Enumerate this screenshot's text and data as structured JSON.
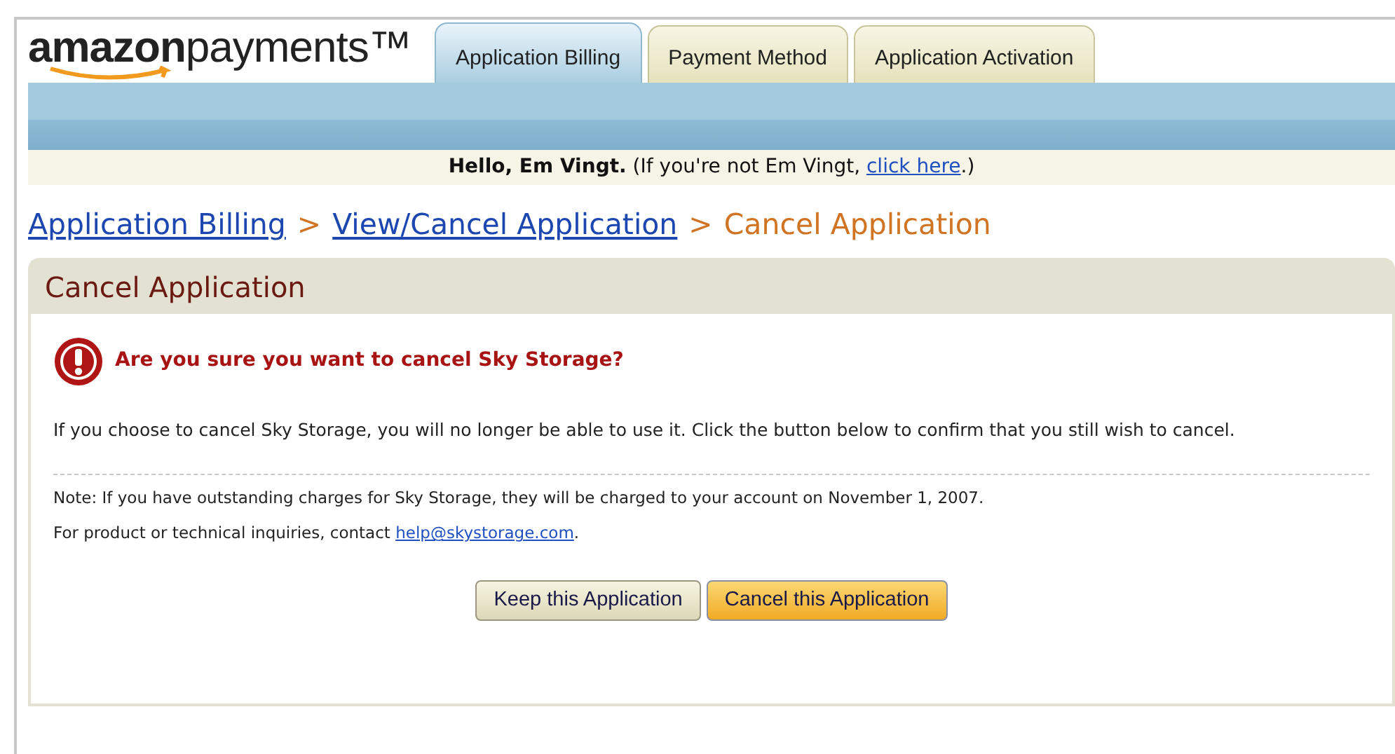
{
  "logo": {
    "text": "**amazon**payments™"
  },
  "tabs": [
    {
      "label": "Application Billing",
      "selected": true
    },
    {
      "label": "Payment Method",
      "selected": false
    },
    {
      "label": "Application Activation",
      "selected": false
    }
  ],
  "greeting": {
    "before": "**Hello, Em Vingt.** (If you're not Em Vingt, ",
    "link": "click here",
    "after": ".)"
  },
  "breadcrumb": [
    {
      "kind": "link",
      "text": "Application Billing"
    },
    {
      "kind": "separator",
      "text": ">"
    },
    {
      "kind": "link",
      "text": "View/Cancel Application"
    },
    {
      "kind": "separator",
      "text": ">"
    },
    {
      "kind": "current",
      "text": "Cancel Application"
    }
  ],
  "panel": {
    "title": "Cancel Application",
    "question": "Are you sure you want to cancel Sky Storage?",
    "message": "If you choose to cancel Sky Storage, you will no longer be able to use it. Click the button below to confirm that you still wish to cancel.",
    "note": "Note: If you have outstanding charges for Sky Storage, they will be charged to your account on November 1, 2007.",
    "contact": {
      "before": "For product or technical inquiries, contact ",
      "link": "help@skystorage.com",
      "after": "."
    },
    "buttons": [
      {
        "label": "Keep this Application",
        "kind": "secondary"
      },
      {
        "label": "Cancel this Application",
        "kind": "primary"
      }
    ]
  }
}
